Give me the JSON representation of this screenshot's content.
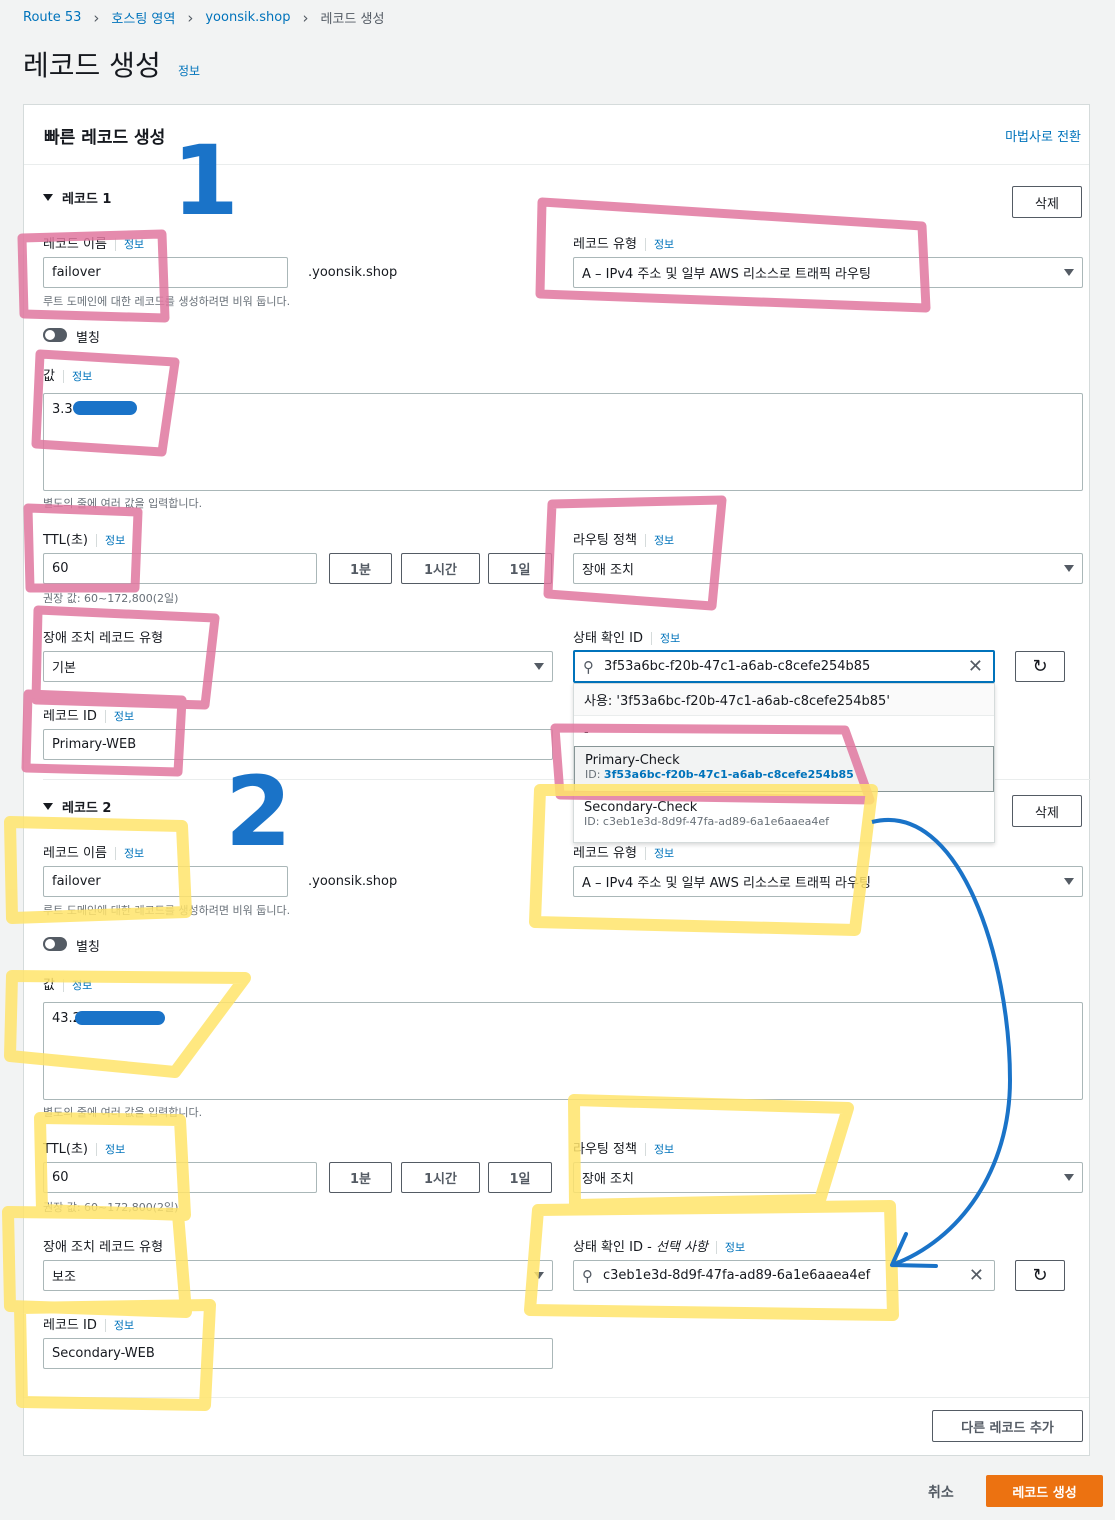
{
  "breadcrumb": {
    "items": [
      "Route 53",
      "호스팅 영역",
      "yoonsik.shop"
    ],
    "current": "레코드 생성"
  },
  "page": {
    "title": "레코드 생성",
    "info": "정보"
  },
  "panel": {
    "title": "빠른 레코드 생성",
    "wizard_link": "마법사로 전환"
  },
  "common": {
    "info": "정보",
    "delete": "삭제",
    "domain_suffix": ".yoonsik.shop",
    "root_hint": "루트 도메인에 대한 레코드를 생성하려면 비워 둡니다.",
    "alias": "별칭",
    "value_hint": "별도의 줄에 여러 값을 입력합니다.",
    "ttl_hint": "권장 값: 60~172,800(2일)",
    "ttl_1m": "1분",
    "ttl_1h": "1시간",
    "ttl_1d": "1일"
  },
  "record1": {
    "heading": "레코드 1",
    "name_label": "레코드 이름",
    "name_value": "failover",
    "type_label": "레코드 유형",
    "type_value": "A – IPv4 주소 및 일부 AWS 리소스로 트래픽 라우팅",
    "value_label": "값",
    "value_value": "3.3",
    "ttl_label": "TTL(초)",
    "ttl_value": "60",
    "policy_label": "라우팅 정책",
    "policy_value": "장애 조치",
    "failover_label": "장애 조치 레코드 유형",
    "failover_value": "기본",
    "health_label": "상태 확인 ID",
    "health_value": "3f53a6bc-f20b-47c1-a6ab-c8cefe254b85",
    "id_label": "레코드 ID",
    "id_value": "Primary-WEB"
  },
  "dropdown": {
    "use": "사용: '3f53a6bc-f20b-47c1-a6ab-c8cefe254b85'",
    "dash": "-",
    "opt1_name": "Primary-Check",
    "opt1_id": "3f53a6bc-f20b-47c1-a6ab-c8cefe254b85",
    "opt1_prefix": "ID: ",
    "opt2_name": "Secondary-Check",
    "opt2_id": "ID: c3eb1e3d-8d9f-47fa-ad89-6a1e6aaea4ef"
  },
  "record2": {
    "heading": "레코드 2",
    "name_label": "레코드 이름",
    "name_value": "failover",
    "type_label": "레코드 유형",
    "type_value": "A – IPv4 주소 및 일부 AWS 리소스로 트래픽 라우팅",
    "value_label": "값",
    "value_value": "43.2",
    "ttl_label": "TTL(초)",
    "ttl_value": "60",
    "policy_label": "라우팅 정책",
    "policy_value": "장애 조치",
    "failover_label": "장애 조치 레코드 유형",
    "failover_value": "보조",
    "health_label": "상태 확인 ID - ",
    "health_optional": "선택 사항",
    "health_value": "c3eb1e3d-8d9f-47fa-ad89-6a1e6aaea4ef",
    "id_label": "레코드 ID",
    "id_value": "Secondary-WEB"
  },
  "footer": {
    "add_record": "다른 레코드 추가",
    "cancel": "취소",
    "create": "레코드 생성"
  },
  "annotations": {
    "num1": "1",
    "num2": "2"
  },
  "colors": {
    "accent": "#ec7211",
    "link": "#0073bb",
    "pink": "#e0779f",
    "yellow": "#ffe46b",
    "blue": "#1a73c8"
  }
}
